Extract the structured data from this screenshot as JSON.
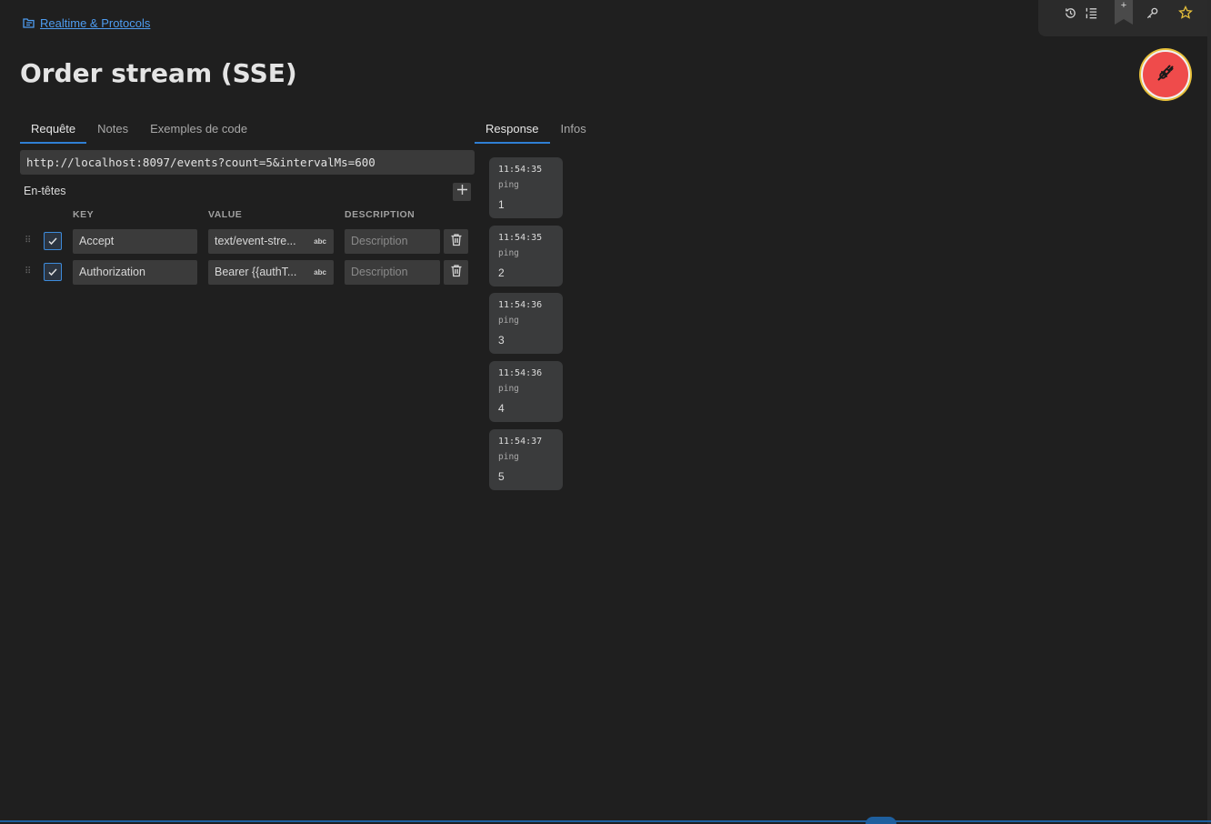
{
  "breadcrumb": {
    "label": "Realtime & Protocols"
  },
  "title": "Order stream (SSE)",
  "request_tabs": [
    "Requête",
    "Notes",
    "Exemples de code"
  ],
  "response_tabs": [
    "Response",
    "Infos"
  ],
  "url": "http://localhost:8097/events?count=5&intervalMs=600",
  "headers": {
    "section_label": "En-têtes",
    "columns": [
      "KEY",
      "VALUE",
      "DESCRIPTION"
    ],
    "value_badge": "abc",
    "rows": [
      {
        "key": "Accept",
        "value": "text/event-stre...",
        "description_placeholder": "Description",
        "enabled": true
      },
      {
        "key": "Authorization",
        "value": "Bearer {{authT...",
        "description_placeholder": "Description",
        "enabled": true
      }
    ]
  },
  "events": [
    {
      "time": "11:54:35",
      "type": "ping",
      "data": "1"
    },
    {
      "time": "11:54:35",
      "type": "ping",
      "data": "2"
    },
    {
      "time": "11:54:36",
      "type": "ping",
      "data": "3"
    },
    {
      "time": "11:54:36",
      "type": "ping",
      "data": "4"
    },
    {
      "time": "11:54:37",
      "type": "ping",
      "data": "5"
    }
  ],
  "toolbar": {
    "icons": [
      "history-icon",
      "list-icon",
      "bookmark-add-icon",
      "key-icon",
      "star-icon"
    ],
    "bookmark_plus": "+"
  },
  "colors": {
    "accent": "#2f7fd4",
    "link": "#4e9cf0",
    "fab_bg": "#ef4b4b",
    "fab_ring": "#e7c03a",
    "star": "#e7c03a"
  }
}
